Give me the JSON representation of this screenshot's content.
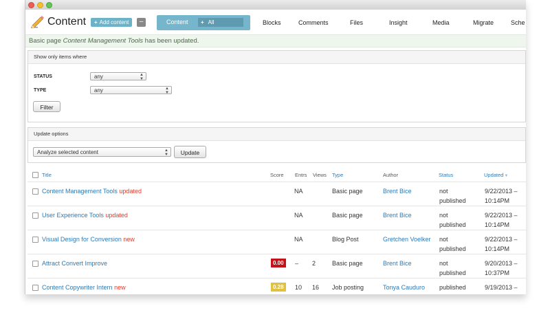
{
  "window": {
    "buttons": [
      "close",
      "minimize",
      "zoom"
    ]
  },
  "header": {
    "title": "Content",
    "add_button": {
      "plus": "+",
      "label": "Add content"
    },
    "minus_button": "–",
    "active_tab": {
      "label": "Content",
      "sub_plus": "+",
      "sub_label": "All"
    },
    "tabs": [
      "Blocks",
      "Comments",
      "Files",
      "Insight",
      "Media",
      "Migrate",
      "Sche"
    ]
  },
  "message": {
    "prefix": "Basic page ",
    "title": "Content Management Tools",
    "suffix": " has been updated."
  },
  "filters": {
    "heading": "Show only items where",
    "status_label": "STATUS",
    "status_value": "any",
    "type_label": "TYPE",
    "type_value": "any",
    "filter_button": "Filter"
  },
  "update_options": {
    "heading": "Update options",
    "action_value": "Analyze selected content",
    "update_button": "Update"
  },
  "table": {
    "headers": {
      "title": "Title",
      "score": "Score",
      "entrs": "Entrs",
      "views": "Views",
      "type": "Type",
      "author": "Author",
      "status": "Status",
      "updated": "Updated"
    },
    "sort_arrow": "▼",
    "rows": [
      {
        "title": "Content Management Tools",
        "tag": "updated",
        "score": "",
        "entrs": "NA",
        "views": "",
        "type": "Basic page",
        "author": "Brent Bice",
        "status1": "not",
        "status2": "published",
        "updated1": "9/22/2013 –",
        "updated2": "10:14PM"
      },
      {
        "title": "User Experience Tools",
        "tag": "updated",
        "score": "",
        "entrs": "NA",
        "views": "",
        "type": "Basic page",
        "author": "Brent Bice",
        "status1": "not",
        "status2": "published",
        "updated1": "9/22/2013 –",
        "updated2": "10:14PM"
      },
      {
        "title": "Visual Design for Conversion",
        "tag": "new",
        "score": "",
        "entrs": "NA",
        "views": "",
        "type": "Blog Post",
        "author": "Gretchen Voelker",
        "status1": "not",
        "status2": "published",
        "updated1": "9/22/2013 –",
        "updated2": "10:14PM"
      },
      {
        "title": "Attract Convert Improve",
        "tag": "",
        "score": "0.00",
        "entrs": "–",
        "views": "2",
        "type": "Basic page",
        "author": "Brent Bice",
        "status1": "not",
        "status2": "published",
        "updated1": "9/20/2013 –",
        "updated2": "10:37PM"
      },
      {
        "title": "Content Copywriter Intern",
        "tag": "new",
        "score": "0.28",
        "entrs": "10",
        "views": "16",
        "type": "Job posting",
        "author": "Tonya Cauduro",
        "status1": "published",
        "status2": "",
        "updated1": "9/19/2013 –",
        "updated2": ""
      }
    ]
  },
  "colors": {
    "accent": "#76b6cc",
    "link": "#2a7ab8",
    "tag": "#e03b2b",
    "score_red": "#c0151b",
    "score_yellow": "#e2c13e"
  }
}
